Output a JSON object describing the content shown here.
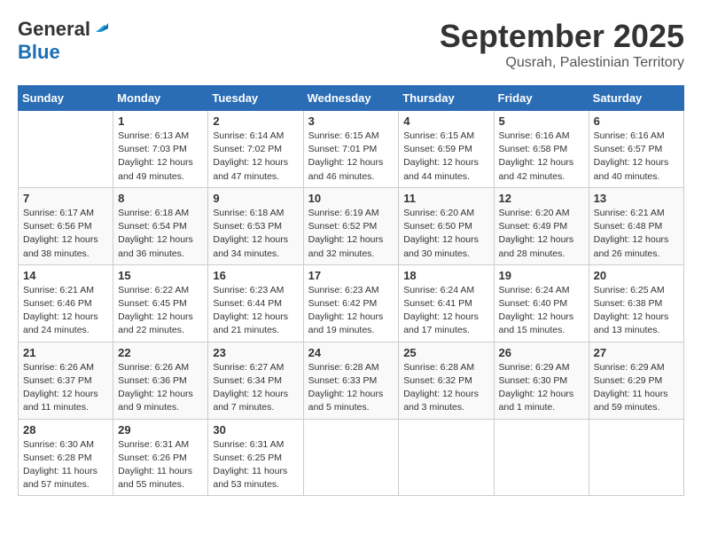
{
  "header": {
    "logo_line1": "General",
    "logo_line2": "Blue",
    "month": "September 2025",
    "location": "Qusrah, Palestinian Territory"
  },
  "days_of_week": [
    "Sunday",
    "Monday",
    "Tuesday",
    "Wednesday",
    "Thursday",
    "Friday",
    "Saturday"
  ],
  "weeks": [
    [
      {
        "day": "",
        "info": ""
      },
      {
        "day": "1",
        "info": "Sunrise: 6:13 AM\nSunset: 7:03 PM\nDaylight: 12 hours\nand 49 minutes."
      },
      {
        "day": "2",
        "info": "Sunrise: 6:14 AM\nSunset: 7:02 PM\nDaylight: 12 hours\nand 47 minutes."
      },
      {
        "day": "3",
        "info": "Sunrise: 6:15 AM\nSunset: 7:01 PM\nDaylight: 12 hours\nand 46 minutes."
      },
      {
        "day": "4",
        "info": "Sunrise: 6:15 AM\nSunset: 6:59 PM\nDaylight: 12 hours\nand 44 minutes."
      },
      {
        "day": "5",
        "info": "Sunrise: 6:16 AM\nSunset: 6:58 PM\nDaylight: 12 hours\nand 42 minutes."
      },
      {
        "day": "6",
        "info": "Sunrise: 6:16 AM\nSunset: 6:57 PM\nDaylight: 12 hours\nand 40 minutes."
      }
    ],
    [
      {
        "day": "7",
        "info": "Sunrise: 6:17 AM\nSunset: 6:56 PM\nDaylight: 12 hours\nand 38 minutes."
      },
      {
        "day": "8",
        "info": "Sunrise: 6:18 AM\nSunset: 6:54 PM\nDaylight: 12 hours\nand 36 minutes."
      },
      {
        "day": "9",
        "info": "Sunrise: 6:18 AM\nSunset: 6:53 PM\nDaylight: 12 hours\nand 34 minutes."
      },
      {
        "day": "10",
        "info": "Sunrise: 6:19 AM\nSunset: 6:52 PM\nDaylight: 12 hours\nand 32 minutes."
      },
      {
        "day": "11",
        "info": "Sunrise: 6:20 AM\nSunset: 6:50 PM\nDaylight: 12 hours\nand 30 minutes."
      },
      {
        "day": "12",
        "info": "Sunrise: 6:20 AM\nSunset: 6:49 PM\nDaylight: 12 hours\nand 28 minutes."
      },
      {
        "day": "13",
        "info": "Sunrise: 6:21 AM\nSunset: 6:48 PM\nDaylight: 12 hours\nand 26 minutes."
      }
    ],
    [
      {
        "day": "14",
        "info": "Sunrise: 6:21 AM\nSunset: 6:46 PM\nDaylight: 12 hours\nand 24 minutes."
      },
      {
        "day": "15",
        "info": "Sunrise: 6:22 AM\nSunset: 6:45 PM\nDaylight: 12 hours\nand 22 minutes."
      },
      {
        "day": "16",
        "info": "Sunrise: 6:23 AM\nSunset: 6:44 PM\nDaylight: 12 hours\nand 21 minutes."
      },
      {
        "day": "17",
        "info": "Sunrise: 6:23 AM\nSunset: 6:42 PM\nDaylight: 12 hours\nand 19 minutes."
      },
      {
        "day": "18",
        "info": "Sunrise: 6:24 AM\nSunset: 6:41 PM\nDaylight: 12 hours\nand 17 minutes."
      },
      {
        "day": "19",
        "info": "Sunrise: 6:24 AM\nSunset: 6:40 PM\nDaylight: 12 hours\nand 15 minutes."
      },
      {
        "day": "20",
        "info": "Sunrise: 6:25 AM\nSunset: 6:38 PM\nDaylight: 12 hours\nand 13 minutes."
      }
    ],
    [
      {
        "day": "21",
        "info": "Sunrise: 6:26 AM\nSunset: 6:37 PM\nDaylight: 12 hours\nand 11 minutes."
      },
      {
        "day": "22",
        "info": "Sunrise: 6:26 AM\nSunset: 6:36 PM\nDaylight: 12 hours\nand 9 minutes."
      },
      {
        "day": "23",
        "info": "Sunrise: 6:27 AM\nSunset: 6:34 PM\nDaylight: 12 hours\nand 7 minutes."
      },
      {
        "day": "24",
        "info": "Sunrise: 6:28 AM\nSunset: 6:33 PM\nDaylight: 12 hours\nand 5 minutes."
      },
      {
        "day": "25",
        "info": "Sunrise: 6:28 AM\nSunset: 6:32 PM\nDaylight: 12 hours\nand 3 minutes."
      },
      {
        "day": "26",
        "info": "Sunrise: 6:29 AM\nSunset: 6:30 PM\nDaylight: 12 hours\nand 1 minute."
      },
      {
        "day": "27",
        "info": "Sunrise: 6:29 AM\nSunset: 6:29 PM\nDaylight: 11 hours\nand 59 minutes."
      }
    ],
    [
      {
        "day": "28",
        "info": "Sunrise: 6:30 AM\nSunset: 6:28 PM\nDaylight: 11 hours\nand 57 minutes."
      },
      {
        "day": "29",
        "info": "Sunrise: 6:31 AM\nSunset: 6:26 PM\nDaylight: 11 hours\nand 55 minutes."
      },
      {
        "day": "30",
        "info": "Sunrise: 6:31 AM\nSunset: 6:25 PM\nDaylight: 11 hours\nand 53 minutes."
      },
      {
        "day": "",
        "info": ""
      },
      {
        "day": "",
        "info": ""
      },
      {
        "day": "",
        "info": ""
      },
      {
        "day": "",
        "info": ""
      }
    ]
  ]
}
